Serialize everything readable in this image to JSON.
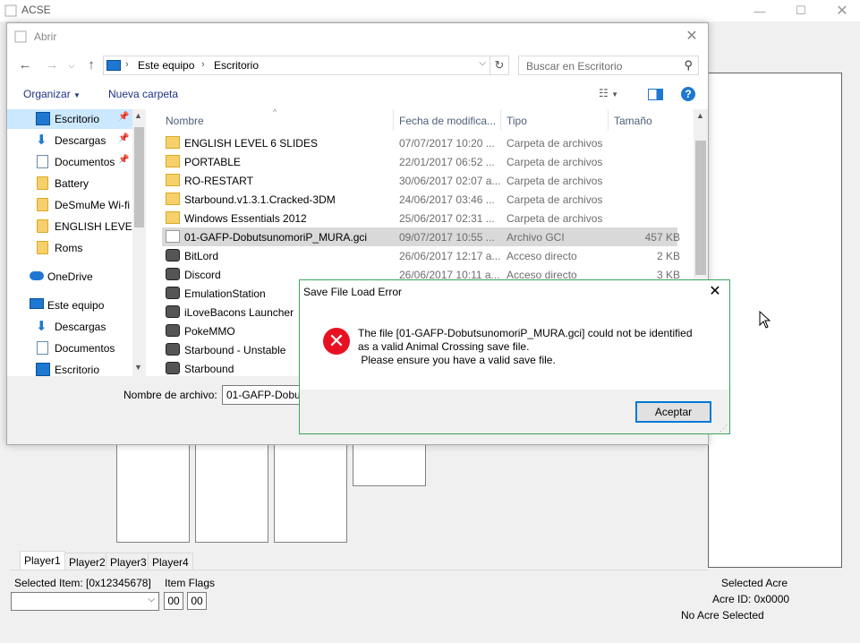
{
  "acse": {
    "title": "ACSE",
    "tabs": [
      "Player1",
      "Player2",
      "Player3",
      "Player4"
    ],
    "selected_item_label": "Selected Item: [0x12345678]",
    "item_flags_label": "Item Flags",
    "flag1": "00",
    "flag2": "00",
    "selected_acre_label": "Selected Acre",
    "acre_id_label": "Acre ID: 0x0000",
    "no_acre_label": "No Acre Selected"
  },
  "dialog": {
    "title": "Abrir",
    "breadcrumb": [
      "Este equipo",
      "Escritorio"
    ],
    "search_placeholder": "Buscar en Escritorio",
    "organize": "Organizar",
    "new_folder": "Nueva carpeta",
    "nav_items": [
      {
        "label": "Escritorio",
        "icon": "desktop-icon"
      },
      {
        "label": "Descargas",
        "icon": "download-icon"
      },
      {
        "label": "Documentos",
        "icon": "document-icon"
      },
      {
        "label": "Battery",
        "icon": "folder-icon"
      },
      {
        "label": "DeSmuMe Wi-fi",
        "icon": "folder-icon"
      },
      {
        "label": "ENGLISH LEVEL 6",
        "icon": "folder-icon"
      },
      {
        "label": "Roms",
        "icon": "folder-icon"
      },
      {
        "label": "OneDrive",
        "icon": "onedrive-icon"
      },
      {
        "label": "Este equipo",
        "icon": "computer-icon"
      },
      {
        "label": "Descargas",
        "icon": "download-icon"
      },
      {
        "label": "Documentos",
        "icon": "document-icon"
      },
      {
        "label": "Escritorio",
        "icon": "desktop-icon"
      }
    ],
    "columns": [
      "Nombre",
      "Fecha de modifica...",
      "Tipo",
      "Tamaño"
    ],
    "files": [
      {
        "name": "ENGLISH LEVEL 6 SLIDES",
        "date": "07/07/2017 10:20 ...",
        "type": "Carpeta de archivos",
        "size": ""
      },
      {
        "name": "PORTABLE",
        "date": "22/01/2017 06:52 ...",
        "type": "Carpeta de archivos",
        "size": ""
      },
      {
        "name": "RO-RESTART",
        "date": "30/06/2017 02:07 a...",
        "type": "Carpeta de archivos",
        "size": ""
      },
      {
        "name": "Starbound.v1.3.1.Cracked-3DM",
        "date": "24/06/2017 03:46 ...",
        "type": "Carpeta de archivos",
        "size": ""
      },
      {
        "name": "Windows Essentials 2012",
        "date": "25/06/2017 02:31 ...",
        "type": "Carpeta de archivos",
        "size": ""
      },
      {
        "name": "01-GAFP-DobutsunomoriP_MURA.gci",
        "date": "09/07/2017 10:55 ...",
        "type": "Archivo GCI",
        "size": "457 KB"
      },
      {
        "name": "BitLord",
        "date": "26/06/2017 12:17 a...",
        "type": "Acceso directo",
        "size": "2 KB"
      },
      {
        "name": "Discord",
        "date": "26/06/2017 10:11 a...",
        "type": "Acceso directo",
        "size": "3 KB"
      },
      {
        "name": "EmulationStation",
        "date": "",
        "type": "",
        "size": ""
      },
      {
        "name": "iLoveBacons Launcher",
        "date": "",
        "type": "",
        "size": ""
      },
      {
        "name": "PokeMMO",
        "date": "",
        "type": "",
        "size": ""
      },
      {
        "name": "Starbound - Unstable",
        "date": "",
        "type": "",
        "size": ""
      },
      {
        "name": "Starbound",
        "date": "",
        "type": "",
        "size": ""
      }
    ],
    "filename_label": "Nombre de archivo:",
    "filename_value": "01-GAFP-DobutsunomoriP_MURA.gci"
  },
  "error": {
    "title": "Save File Load Error",
    "message": "The file [01-GAFP-DobutsunomoriP_MURA.gci] could not be identified\nas a valid Animal Crossing save file.\n Please ensure you have a valid save file.",
    "ok": "Aceptar"
  }
}
